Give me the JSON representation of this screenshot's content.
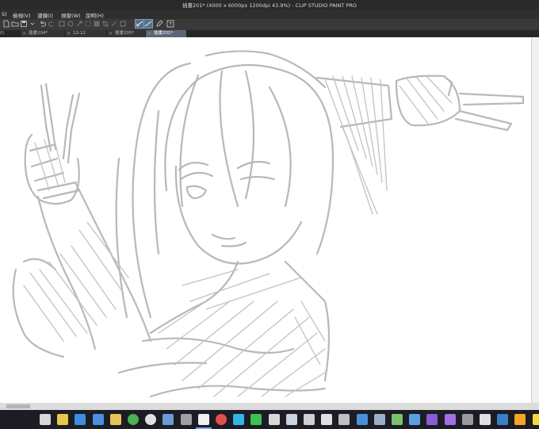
{
  "window": {
    "title": "插畫201* (4000 x 6000px 1200dpi 43.9%)  - CLIP STUDIO PAINT PRO"
  },
  "menu": {
    "items": [
      {
        "id": "edge",
        "label": "S)"
      },
      {
        "id": "view",
        "label": "檢視(V)"
      },
      {
        "id": "filter",
        "label": "濾鏡(I)"
      },
      {
        "id": "window",
        "label": "視窗(W)"
      },
      {
        "id": "help",
        "label": "說明(H)"
      }
    ]
  },
  "tabs": {
    "edge_label": "0)",
    "items": [
      {
        "label": "插畫204*",
        "active": false
      },
      {
        "label": "12-12",
        "active": false
      },
      {
        "label": "插畫205*",
        "active": false
      },
      {
        "label": "插畫201*",
        "active": true
      }
    ]
  },
  "toolbar": {
    "icons": [
      "new-file",
      "open-file",
      "save",
      "undo",
      "redo",
      "clear",
      "fill",
      "transform",
      "deselect",
      "invert-selection",
      "crop",
      "show-selection-area",
      "snap-ruler",
      "snap-special-ruler",
      "edit-mode",
      "help"
    ]
  },
  "taskbar": {
    "icons": [
      {
        "name": "task-view-icon",
        "color": "#d6d6d6"
      },
      {
        "name": "calendar-icon",
        "color": "#e6c84a"
      },
      {
        "name": "edge-browser-icon",
        "color": "#3b8de0"
      },
      {
        "name": "mail-icon",
        "color": "#4a8fe0"
      },
      {
        "name": "file-explorer-icon",
        "color": "#e8c35a"
      },
      {
        "name": "chrome-icon",
        "color": "#4caf50"
      },
      {
        "name": "app-circle-icon",
        "color": "#e0e0e0"
      },
      {
        "name": "photos-icon",
        "color": "#6a9bd8"
      },
      {
        "name": "media-icon",
        "color": "#a0a0a0"
      },
      {
        "name": "clip-studio-paint-icon",
        "color": "#f0f0f0"
      },
      {
        "name": "record-icon",
        "color": "#e05050"
      },
      {
        "name": "messenger-icon",
        "color": "#33b5e5"
      },
      {
        "name": "line-icon",
        "color": "#3cc251"
      },
      {
        "name": "puzzle-icon",
        "color": "#d8d8d8"
      },
      {
        "name": "steam-icon",
        "color": "#c8d4e0"
      },
      {
        "name": "store-icon",
        "color": "#d0d0d0"
      },
      {
        "name": "unity-icon",
        "color": "#e0e0e0"
      },
      {
        "name": "game-icon",
        "color": "#c0c0c0"
      },
      {
        "name": "tv-icon",
        "color": "#4a90d9"
      },
      {
        "name": "controller-icon",
        "color": "#9ab0c8"
      },
      {
        "name": "notepad-icon",
        "color": "#7cc26b"
      },
      {
        "name": "photo-viewer-icon",
        "color": "#5aa0e0"
      },
      {
        "name": "visual-studio-icon",
        "color": "#8a5bd6"
      },
      {
        "name": "vs-code-icon",
        "color": "#a070e0"
      },
      {
        "name": "cortana-icon",
        "color": "#9a9a9a"
      },
      {
        "name": "settings-icon",
        "color": "#e0e0e0"
      },
      {
        "name": "calculator-icon",
        "color": "#3b7fc4"
      },
      {
        "name": "illustrator-icon",
        "color": "#f5a623"
      },
      {
        "name": "sticky-notes-icon",
        "color": "#f7d83a"
      }
    ]
  }
}
